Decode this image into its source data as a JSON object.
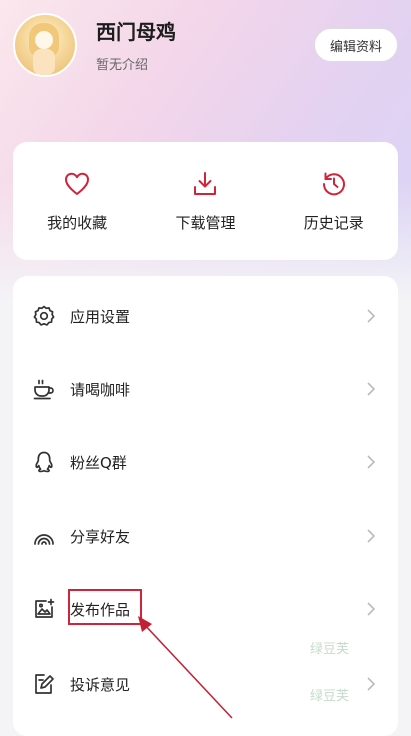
{
  "profile": {
    "name": "西门母鸡",
    "bio": "暂无介绍",
    "edit_label": "编辑资料"
  },
  "quick_actions": [
    {
      "label": "我的收藏",
      "icon": "heart-icon"
    },
    {
      "label": "下载管理",
      "icon": "download-icon"
    },
    {
      "label": "历史记录",
      "icon": "history-icon"
    }
  ],
  "menu": [
    {
      "label": "应用设置",
      "icon": "gear-icon"
    },
    {
      "label": "请喝咖啡",
      "icon": "coffee-icon"
    },
    {
      "label": "粉丝Q群",
      "icon": "qq-icon"
    },
    {
      "label": "分享好友",
      "icon": "share-icon"
    },
    {
      "label": "发布作品",
      "icon": "publish-icon"
    },
    {
      "label": "投诉意见",
      "icon": "feedback-icon"
    }
  ],
  "watermark": [
    "绿豆芙",
    "绿豆芙"
  ],
  "colors": {
    "accent": "#d0243a",
    "highlight_box": "#d0243a"
  }
}
